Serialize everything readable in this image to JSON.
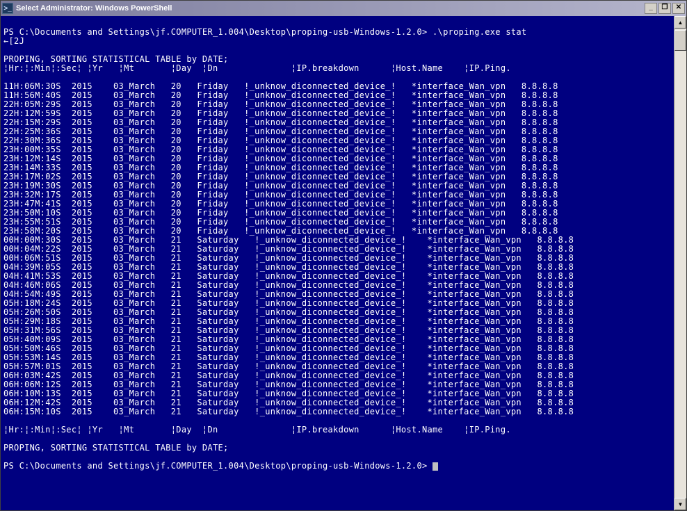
{
  "titlebar": {
    "icon_glyph": ">_",
    "text": "Select Administrator: Windows PowerShell",
    "min_label": "_",
    "max_label": "❐",
    "close_label": "✕"
  },
  "console": {
    "prompt1": "PS C:\\Documents and Settings\\jf.COMPUTER_1.004\\Desktop\\proping-usb-Windows-1.2.0> .\\proping.exe stat",
    "escape_line": "←[2J",
    "heading": "PROPING, SORTING STATISTICAL TABLE by DATE;",
    "header_row": "¦Hr:¦:Min¦:Sec¦ ¦Yr   ¦Mt       ¦Day  ¦Dn              ¦IP.breakdown      ¦Host.Name    ¦IP.Ping.",
    "footer_row": "¦Hr:¦:Min¦:Sec¦ ¦Yr   ¦Mt       ¦Day  ¦Dn              ¦IP.breakdown      ¦Host.Name    ¦IP.Ping.",
    "rows_friday": [
      {
        "time": "11H:06M:30S",
        "yr": "2015",
        "mt": "03_March",
        "day": "20",
        "dn": "Friday",
        "dev": "!_unknow_diconnected_device_!",
        "host": "*interface_Wan_vpn",
        "ip": "8.8.8.8"
      },
      {
        "time": "11H:56M:40S",
        "yr": "2015",
        "mt": "03_March",
        "day": "20",
        "dn": "Friday",
        "dev": "!_unknow_diconnected_device_!",
        "host": "*interface_Wan_vpn",
        "ip": "8.8.8.8"
      },
      {
        "time": "22H:05M:29S",
        "yr": "2015",
        "mt": "03_March",
        "day": "20",
        "dn": "Friday",
        "dev": "!_unknow_diconnected_device_!",
        "host": "*interface_Wan_vpn",
        "ip": "8.8.8.8"
      },
      {
        "time": "22H:12M:59S",
        "yr": "2015",
        "mt": "03_March",
        "day": "20",
        "dn": "Friday",
        "dev": "!_unknow_diconnected_device_!",
        "host": "*interface_Wan_vpn",
        "ip": "8.8.8.8"
      },
      {
        "time": "22H:15M:29S",
        "yr": "2015",
        "mt": "03_March",
        "day": "20",
        "dn": "Friday",
        "dev": "!_unknow_diconnected_device_!",
        "host": "*interface_Wan_vpn",
        "ip": "8.8.8.8"
      },
      {
        "time": "22H:25M:36S",
        "yr": "2015",
        "mt": "03_March",
        "day": "20",
        "dn": "Friday",
        "dev": "!_unknow_diconnected_device_!",
        "host": "*interface_Wan_vpn",
        "ip": "8.8.8.8"
      },
      {
        "time": "22H:30M:36S",
        "yr": "2015",
        "mt": "03_March",
        "day": "20",
        "dn": "Friday",
        "dev": "!_unknow_diconnected_device_!",
        "host": "*interface_Wan_vpn",
        "ip": "8.8.8.8"
      },
      {
        "time": "23H:00M:35S",
        "yr": "2015",
        "mt": "03_March",
        "day": "20",
        "dn": "Friday",
        "dev": "!_unknow_diconnected_device_!",
        "host": "*interface_Wan_vpn",
        "ip": "8.8.8.8"
      },
      {
        "time": "23H:12M:14S",
        "yr": "2015",
        "mt": "03_March",
        "day": "20",
        "dn": "Friday",
        "dev": "!_unknow_diconnected_device_!",
        "host": "*interface_Wan_vpn",
        "ip": "8.8.8.8"
      },
      {
        "time": "23H:14M:33S",
        "yr": "2015",
        "mt": "03_March",
        "day": "20",
        "dn": "Friday",
        "dev": "!_unknow_diconnected_device_!",
        "host": "*interface_Wan_vpn",
        "ip": "8.8.8.8"
      },
      {
        "time": "23H:17M:02S",
        "yr": "2015",
        "mt": "03_March",
        "day": "20",
        "dn": "Friday",
        "dev": "!_unknow_diconnected_device_!",
        "host": "*interface_Wan_vpn",
        "ip": "8.8.8.8"
      },
      {
        "time": "23H:19M:30S",
        "yr": "2015",
        "mt": "03_March",
        "day": "20",
        "dn": "Friday",
        "dev": "!_unknow_diconnected_device_!",
        "host": "*interface_Wan_vpn",
        "ip": "8.8.8.8"
      },
      {
        "time": "23H:32M:17S",
        "yr": "2015",
        "mt": "03_March",
        "day": "20",
        "dn": "Friday",
        "dev": "!_unknow_diconnected_device_!",
        "host": "*interface_Wan_vpn",
        "ip": "8.8.8.8"
      },
      {
        "time": "23H:47M:41S",
        "yr": "2015",
        "mt": "03_March",
        "day": "20",
        "dn": "Friday",
        "dev": "!_unknow_diconnected_device_!",
        "host": "*interface_Wan_vpn",
        "ip": "8.8.8.8"
      },
      {
        "time": "23H:50M:10S",
        "yr": "2015",
        "mt": "03_March",
        "day": "20",
        "dn": "Friday",
        "dev": "!_unknow_diconnected_device_!",
        "host": "*interface_Wan_vpn",
        "ip": "8.8.8.8"
      },
      {
        "time": "23H:55M:51S",
        "yr": "2015",
        "mt": "03_March",
        "day": "20",
        "dn": "Friday",
        "dev": "!_unknow_diconnected_device_!",
        "host": "*interface_Wan_vpn",
        "ip": "8.8.8.8"
      },
      {
        "time": "23H:58M:20S",
        "yr": "2015",
        "mt": "03_March",
        "day": "20",
        "dn": "Friday",
        "dev": "!_unknow_diconnected_device_!",
        "host": "*interface_Wan_vpn",
        "ip": "8.8.8.8"
      }
    ],
    "rows_saturday": [
      {
        "time": "00H:00M:30S",
        "yr": "2015",
        "mt": "03_March",
        "day": "21",
        "dn": "Saturday",
        "dev": "!_unknow_diconnected_device_!",
        "host": "*interface_Wan_vpn",
        "ip": "8.8.8.8"
      },
      {
        "time": "00H:04M:22S",
        "yr": "2015",
        "mt": "03_March",
        "day": "21",
        "dn": "Saturday",
        "dev": "!_unknow_diconnected_device_!",
        "host": "*interface_Wan_vpn",
        "ip": "8.8.8.8"
      },
      {
        "time": "00H:06M:51S",
        "yr": "2015",
        "mt": "03_March",
        "day": "21",
        "dn": "Saturday",
        "dev": "!_unknow_diconnected_device_!",
        "host": "*interface_Wan_vpn",
        "ip": "8.8.8.8"
      },
      {
        "time": "04H:39M:05S",
        "yr": "2015",
        "mt": "03_March",
        "day": "21",
        "dn": "Saturday",
        "dev": "!_unknow_diconnected_device_!",
        "host": "*interface_Wan_vpn",
        "ip": "8.8.8.8"
      },
      {
        "time": "04H:41M:53S",
        "yr": "2015",
        "mt": "03_March",
        "day": "21",
        "dn": "Saturday",
        "dev": "!_unknow_diconnected_device_!",
        "host": "*interface_Wan_vpn",
        "ip": "8.8.8.8"
      },
      {
        "time": "04H:46M:06S",
        "yr": "2015",
        "mt": "03_March",
        "day": "21",
        "dn": "Saturday",
        "dev": "!_unknow_diconnected_device_!",
        "host": "*interface_Wan_vpn",
        "ip": "8.8.8.8"
      },
      {
        "time": "04H:54M:49S",
        "yr": "2015",
        "mt": "03_March",
        "day": "21",
        "dn": "Saturday",
        "dev": "!_unknow_diconnected_device_!",
        "host": "*interface_Wan_vpn",
        "ip": "8.8.8.8"
      },
      {
        "time": "05H:18M:24S",
        "yr": "2015",
        "mt": "03_March",
        "day": "21",
        "dn": "Saturday",
        "dev": "!_unknow_diconnected_device_!",
        "host": "*interface_Wan_vpn",
        "ip": "8.8.8.8"
      },
      {
        "time": "05H:26M:50S",
        "yr": "2015",
        "mt": "03_March",
        "day": "21",
        "dn": "Saturday",
        "dev": "!_unknow_diconnected_device_!",
        "host": "*interface_Wan_vpn",
        "ip": "8.8.8.8"
      },
      {
        "time": "05H:29M:18S",
        "yr": "2015",
        "mt": "03_March",
        "day": "21",
        "dn": "Saturday",
        "dev": "!_unknow_diconnected_device_!",
        "host": "*interface_Wan_vpn",
        "ip": "8.8.8.8"
      },
      {
        "time": "05H:31M:56S",
        "yr": "2015",
        "mt": "03_March",
        "day": "21",
        "dn": "Saturday",
        "dev": "!_unknow_diconnected_device_!",
        "host": "*interface_Wan_vpn",
        "ip": "8.8.8.8"
      },
      {
        "time": "05H:40M:09S",
        "yr": "2015",
        "mt": "03_March",
        "day": "21",
        "dn": "Saturday",
        "dev": "!_unknow_diconnected_device_!",
        "host": "*interface_Wan_vpn",
        "ip": "8.8.8.8"
      },
      {
        "time": "05H:50M:46S",
        "yr": "2015",
        "mt": "03_March",
        "day": "21",
        "dn": "Saturday",
        "dev": "!_unknow_diconnected_device_!",
        "host": "*interface_Wan_vpn",
        "ip": "8.8.8.8"
      },
      {
        "time": "05H:53M:14S",
        "yr": "2015",
        "mt": "03_March",
        "day": "21",
        "dn": "Saturday",
        "dev": "!_unknow_diconnected_device_!",
        "host": "*interface_Wan_vpn",
        "ip": "8.8.8.8"
      },
      {
        "time": "05H:57M:01S",
        "yr": "2015",
        "mt": "03_March",
        "day": "21",
        "dn": "Saturday",
        "dev": "!_unknow_diconnected_device_!",
        "host": "*interface_Wan_vpn",
        "ip": "8.8.8.8"
      },
      {
        "time": "06H:03M:42S",
        "yr": "2015",
        "mt": "03_March",
        "day": "21",
        "dn": "Saturday",
        "dev": "!_unknow_diconnected_device_!",
        "host": "*interface_Wan_vpn",
        "ip": "8.8.8.8"
      },
      {
        "time": "06H:06M:12S",
        "yr": "2015",
        "mt": "03_March",
        "day": "21",
        "dn": "Saturday",
        "dev": "!_unknow_diconnected_device_!",
        "host": "*interface_Wan_vpn",
        "ip": "8.8.8.8"
      },
      {
        "time": "06H:10M:13S",
        "yr": "2015",
        "mt": "03_March",
        "day": "21",
        "dn": "Saturday",
        "dev": "!_unknow_diconnected_device_!",
        "host": "*interface_Wan_vpn",
        "ip": "8.8.8.8"
      },
      {
        "time": "06H:12M:42S",
        "yr": "2015",
        "mt": "03_March",
        "day": "21",
        "dn": "Saturday",
        "dev": "!_unknow_diconnected_device_!",
        "host": "*interface_Wan_vpn",
        "ip": "8.8.8.8"
      },
      {
        "time": "06H:15M:10S",
        "yr": "2015",
        "mt": "03_March",
        "day": "21",
        "dn": "Saturday",
        "dev": "!_unknow_diconnected_device_!",
        "host": "*interface_Wan_vpn",
        "ip": "8.8.8.8"
      }
    ],
    "prompt2": "PS C:\\Documents and Settings\\jf.COMPUTER_1.004\\Desktop\\proping-usb-Windows-1.2.0> "
  },
  "scrollbar": {
    "up": "▲",
    "down": "▼"
  }
}
